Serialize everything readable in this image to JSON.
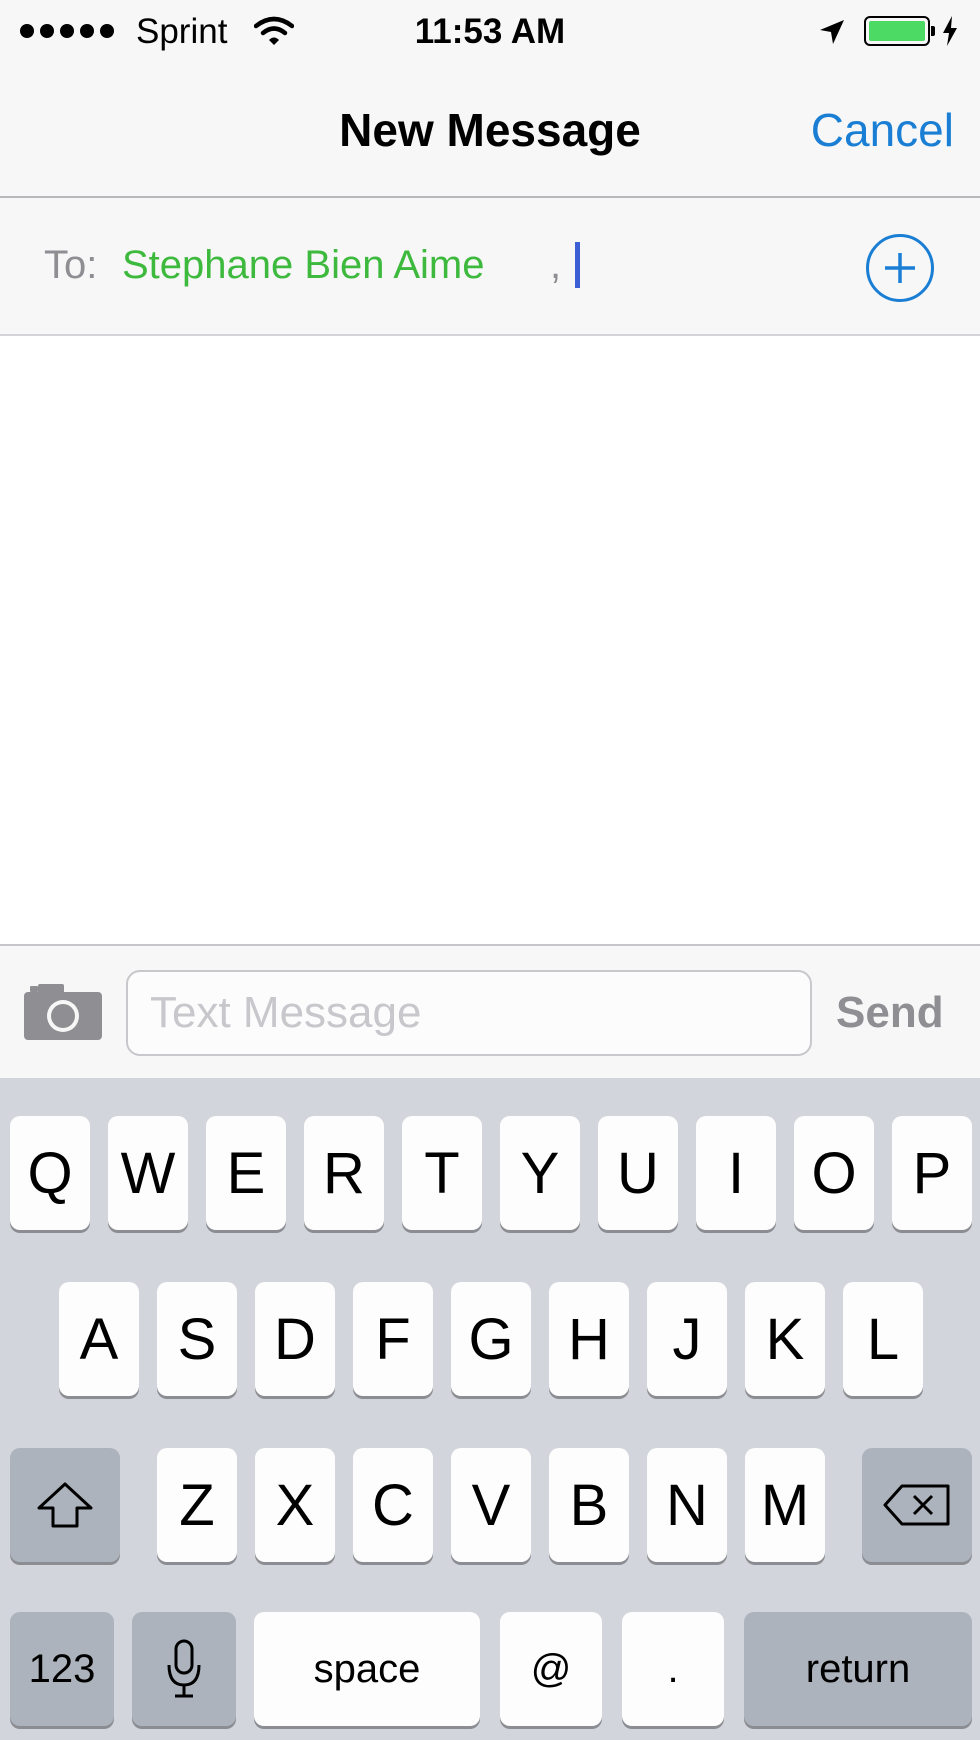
{
  "status_bar": {
    "carrier": "Sprint",
    "time": "11:53 AM",
    "signal_bars": 5,
    "battery_level": 1.0,
    "battery_color": "#4cd964"
  },
  "nav": {
    "title": "New Message",
    "cancel_label": "Cancel"
  },
  "to_field": {
    "label": "To:",
    "recipient": "Stephane Bien Aime",
    "separator": ",",
    "add_icon": "plus-circle-icon"
  },
  "compose": {
    "camera_icon": "camera-icon",
    "placeholder": "Text Message",
    "send_label": "Send"
  },
  "keyboard": {
    "row1": [
      "Q",
      "W",
      "E",
      "R",
      "T",
      "Y",
      "U",
      "I",
      "O",
      "P"
    ],
    "row2": [
      "A",
      "S",
      "D",
      "F",
      "G",
      "H",
      "J",
      "K",
      "L"
    ],
    "row3": [
      "Z",
      "X",
      "C",
      "V",
      "B",
      "N",
      "M"
    ],
    "shift_icon": "shift-arrow-icon",
    "delete_icon": "backspace-icon",
    "numbers_label": "123",
    "mic_icon": "microphone-icon",
    "space_label": "space",
    "at_label": "@",
    "dot_label": ".",
    "return_label": "return"
  },
  "colors": {
    "accent": "#1a7fd4",
    "recipient": "#3dba3d",
    "caret": "#3d5fd6"
  }
}
